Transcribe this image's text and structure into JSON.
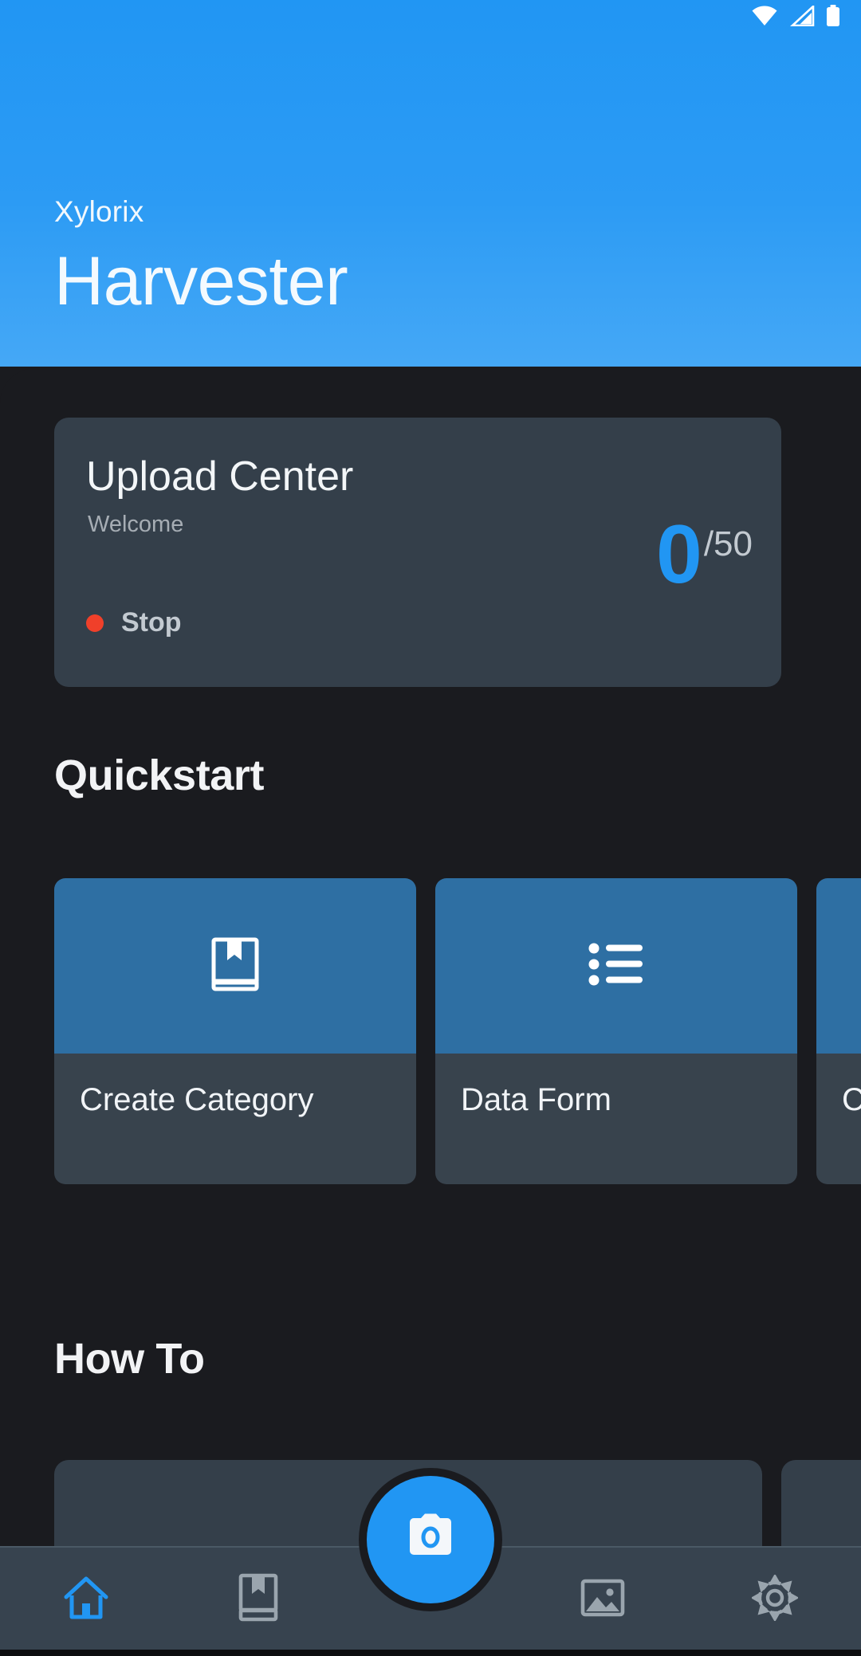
{
  "statusbar": {
    "icons": [
      "wifi-icon",
      "cellular-signal-icon",
      "battery-icon"
    ]
  },
  "header": {
    "brand": "Xylorix",
    "title": "Harvester",
    "gradient_from": "#2196f3",
    "gradient_to": "#45a8f6"
  },
  "upload_card": {
    "title": "Upload Center",
    "subtitle": "Welcome",
    "status_label": "Stop",
    "status_dot_color": "#f0402a",
    "count": "0",
    "total": "/50",
    "count_color": "#2196f3",
    "card_color": "#343f4a"
  },
  "quickstart": {
    "heading": "Quickstart",
    "cards": [
      {
        "label": "Create Category",
        "icon": "book-bookmark-icon"
      },
      {
        "label": "Data Form",
        "icon": "bulleted-list-icon"
      },
      {
        "label": "Ch",
        "icon": "partial-icon"
      }
    ],
    "icon_tile_color": "#2e6fa3",
    "card_color": "#38434d"
  },
  "howto": {
    "heading": "How To"
  },
  "bottom_nav": {
    "items": [
      {
        "name": "home",
        "icon": "home-icon",
        "active": true
      },
      {
        "name": "book",
        "icon": "book-bookmark-icon",
        "active": false
      },
      {
        "name": "gallery",
        "icon": "image-icon",
        "active": false
      },
      {
        "name": "settings",
        "icon": "gear-icon",
        "active": false
      }
    ],
    "fab": {
      "icon": "camera-icon",
      "color": "#2196f3"
    },
    "active_color": "#2196f3",
    "inactive_color": "#9aa5ae",
    "bar_color": "#37434f"
  }
}
